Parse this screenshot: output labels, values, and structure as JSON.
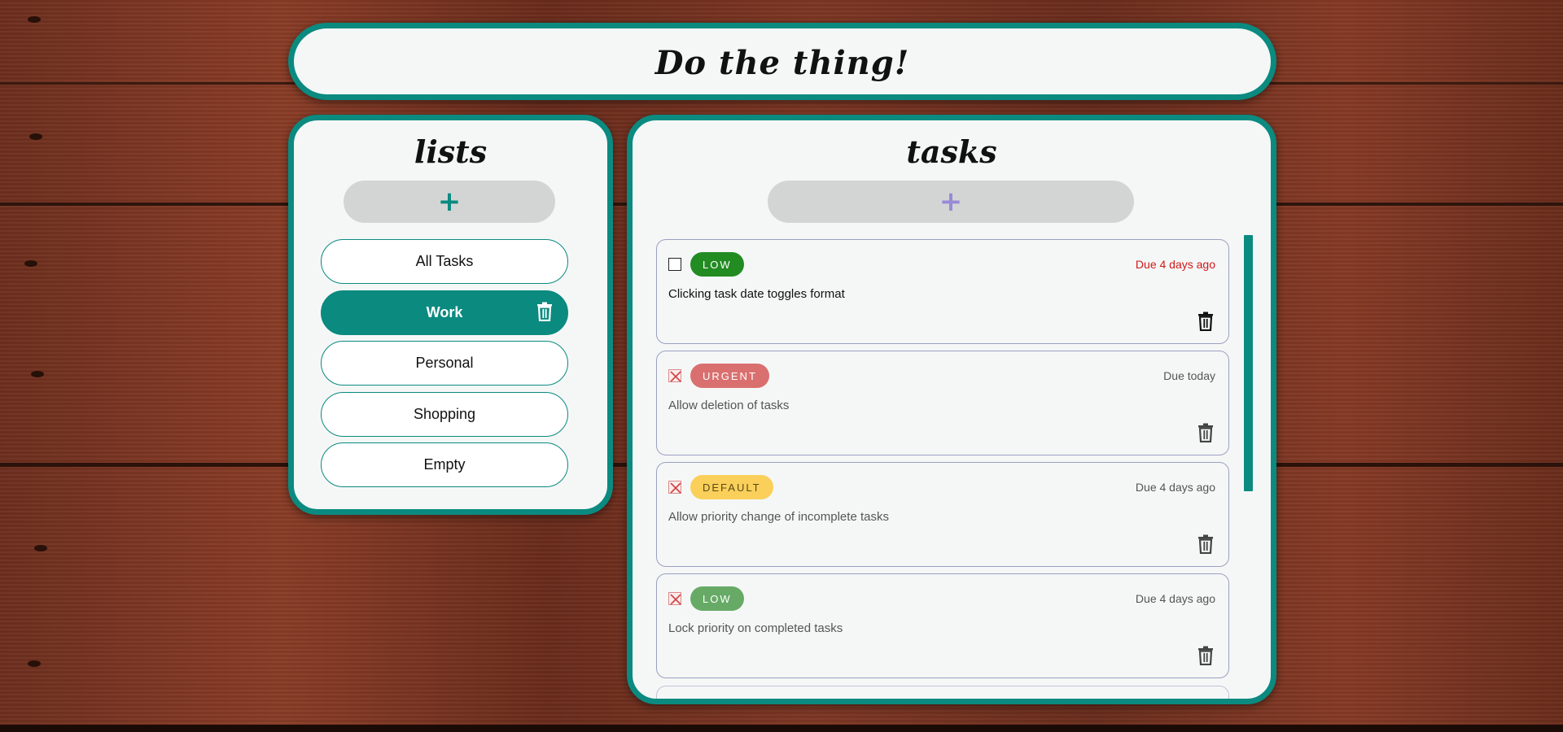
{
  "app": {
    "title": "Do the thing!"
  },
  "lists_panel": {
    "title": "lists",
    "add_label": "+",
    "items": [
      {
        "label": "All Tasks",
        "active": false
      },
      {
        "label": "Work",
        "active": true
      },
      {
        "label": "Personal",
        "active": false
      },
      {
        "label": "Shopping",
        "active": false
      },
      {
        "label": "Empty",
        "active": false
      }
    ]
  },
  "tasks_panel": {
    "title": "tasks",
    "add_label": "+",
    "tasks": [
      {
        "completed": false,
        "priority": "LOW",
        "priority_color": "#228b22",
        "due": "Due 4 days ago",
        "due_overdue": true,
        "text": "Clicking task date toggles format"
      },
      {
        "completed": true,
        "priority": "URGENT",
        "priority_color": "#d9706f",
        "due": "Due today",
        "due_overdue": false,
        "text": "Allow deletion of tasks"
      },
      {
        "completed": true,
        "priority": "DEFAULT",
        "priority_color": "#fad05a",
        "due": "Due 4 days ago",
        "due_overdue": false,
        "text": "Allow priority change of incomplete tasks"
      },
      {
        "completed": true,
        "priority": "LOW",
        "priority_color": "#66aa66",
        "due": "Due 4 days ago",
        "due_overdue": false,
        "text": "Lock priority on completed tasks"
      }
    ]
  },
  "colors": {
    "accent": "#0b8a80",
    "panel_bg": "#f5f7f7",
    "overdue": "#d01818"
  },
  "icons": {
    "trash": "trash-icon",
    "checkbox_checked": "x-box-icon"
  }
}
